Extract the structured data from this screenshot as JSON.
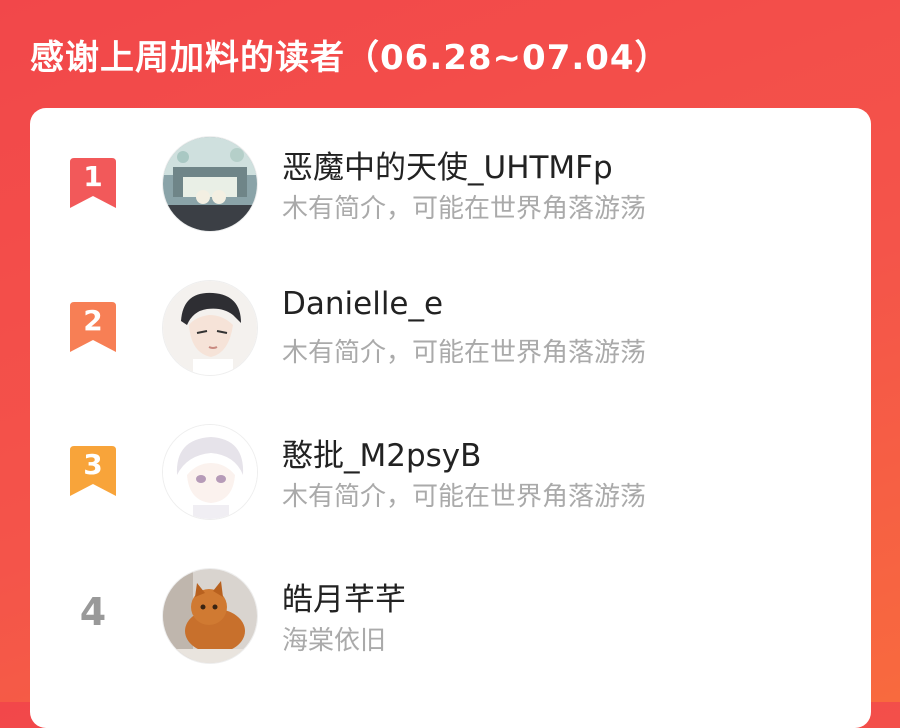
{
  "header": {
    "title": "感谢上周加料的读者（06.28~07.04）"
  },
  "readers": [
    {
      "rank": "1",
      "name": "恶魔中的天使_UHTMFp",
      "bio": "木有简介，可能在世界角落游荡",
      "avatar": "avatar-stage-image",
      "badge_color": "#f2595a"
    },
    {
      "rank": "2",
      "name": "Danielle_e",
      "bio": "木有简介，可能在世界角落游荡",
      "avatar": "avatar-anime-boy-image",
      "badge_color": "#f77f55"
    },
    {
      "rank": "3",
      "name": "憨批_M2psyB",
      "bio": "木有简介，可能在世界角落游荡",
      "avatar": "avatar-anime-white-hair-image",
      "badge_color": "#f8a43a"
    },
    {
      "rank": "4",
      "name": "皓月芊芊",
      "bio": "海棠依旧",
      "avatar": "avatar-cat-image"
    }
  ]
}
